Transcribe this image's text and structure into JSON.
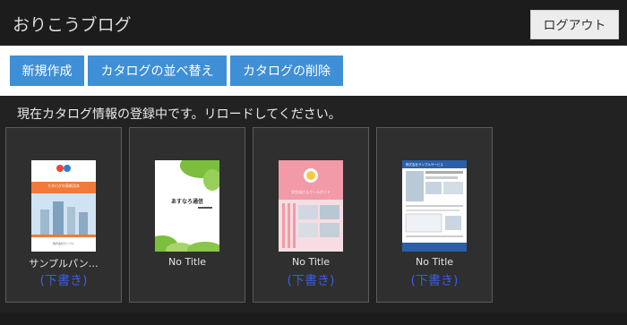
{
  "header": {
    "title": "おりこうブログ",
    "logout_label": "ログアウト"
  },
  "toolbar": {
    "new_label": "新規作成",
    "sort_label": "カタログの並べ替え",
    "delete_label": "カタログの削除"
  },
  "status_text": "現在カタログ情報の登録中です。リロードしてください。",
  "catalogs": [
    {
      "title": "サンプルパン…",
      "status": "(下書き)",
      "thumb_title": "カタログの表紙見本",
      "thumb_footer": "株式会社サンプル"
    },
    {
      "title": "No Title",
      "thumb_title": "あすなろ通信"
    },
    {
      "title": "No Title",
      "status": "(下書き)",
      "thumb_title": "学生向けスクールガイド"
    },
    {
      "title": "No Title",
      "status": "(下書き)",
      "thumb_title": "株式会社サンプルサービス"
    }
  ],
  "colors": {
    "accent": "#3f8fd6",
    "draft": "#3a5fe0",
    "background": "#222222"
  }
}
